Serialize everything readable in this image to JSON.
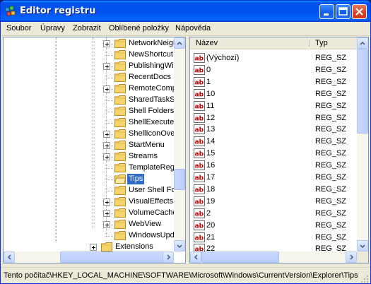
{
  "window": {
    "title": "Editor registru"
  },
  "menu": [
    "Soubor",
    "Úpravy",
    "Zobrazit",
    "Oblíbené položky",
    "Nápověda"
  ],
  "tree": {
    "items": [
      {
        "label": "NetworkNeigh",
        "expandable": true
      },
      {
        "label": "NewShortcut",
        "expandable": false
      },
      {
        "label": "PublishingWiz",
        "expandable": true
      },
      {
        "label": "RecentDocs",
        "expandable": false
      },
      {
        "label": "RemoteComp",
        "expandable": true
      },
      {
        "label": "SharedTaskS",
        "expandable": false
      },
      {
        "label": "Shell Folders",
        "expandable": false
      },
      {
        "label": "ShellExecute",
        "expandable": false
      },
      {
        "label": "ShellIconOve",
        "expandable": true
      },
      {
        "label": "StartMenu",
        "expandable": true
      },
      {
        "label": "Streams",
        "expandable": true
      },
      {
        "label": "TemplateReg",
        "expandable": false
      },
      {
        "label": "Tips",
        "expandable": false,
        "selected": true
      },
      {
        "label": "User Shell Fo",
        "expandable": false
      },
      {
        "label": "VisualEffects",
        "expandable": true
      },
      {
        "label": "VolumeCache",
        "expandable": true
      },
      {
        "label": "WebView",
        "expandable": true
      },
      {
        "label": "WindowsUpd",
        "expandable": false
      }
    ],
    "parent_item": {
      "label": "Extensions",
      "expandable": true
    }
  },
  "list": {
    "columns": {
      "name": "Název",
      "type": "Typ"
    },
    "rows": [
      {
        "name": "(Výchozí)",
        "type": "REG_SZ"
      },
      {
        "name": "0",
        "type": "REG_SZ"
      },
      {
        "name": "1",
        "type": "REG_SZ"
      },
      {
        "name": "10",
        "type": "REG_SZ"
      },
      {
        "name": "11",
        "type": "REG_SZ"
      },
      {
        "name": "12",
        "type": "REG_SZ"
      },
      {
        "name": "13",
        "type": "REG_SZ"
      },
      {
        "name": "14",
        "type": "REG_SZ"
      },
      {
        "name": "15",
        "type": "REG_SZ"
      },
      {
        "name": "16",
        "type": "REG_SZ"
      },
      {
        "name": "17",
        "type": "REG_SZ"
      },
      {
        "name": "18",
        "type": "REG_SZ"
      },
      {
        "name": "19",
        "type": "REG_SZ"
      },
      {
        "name": "2",
        "type": "REG_SZ"
      },
      {
        "name": "20",
        "type": "REG_SZ"
      },
      {
        "name": "21",
        "type": "REG_SZ"
      },
      {
        "name": "22",
        "type": "REG_SZ"
      }
    ],
    "icon": "reg-string-icon",
    "icon_text": "ab"
  },
  "status": {
    "path": "Tento počítač\\HKEY_LOCAL_MACHINE\\SOFTWARE\\Microsoft\\Windows\\CurrentVersion\\Explorer\\Tips"
  },
  "colors": {
    "titlebar": "#0053ee",
    "selection": "#316ac5",
    "folder": "#f5d56b"
  }
}
